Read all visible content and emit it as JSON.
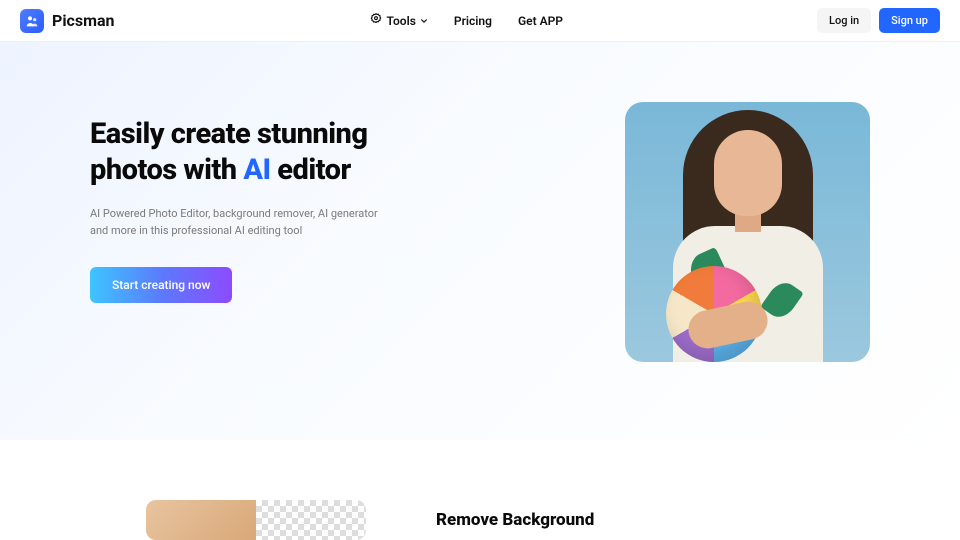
{
  "brand": "Picsman",
  "nav": {
    "tools": "Tools",
    "pricing": "Pricing",
    "getapp": "Get APP"
  },
  "auth": {
    "login": "Log in",
    "signup": "Sign up"
  },
  "hero": {
    "headline_pre": "Easily create stunning photos with ",
    "headline_ai": "AI",
    "headline_post": " editor",
    "subtitle": "AI Powered Photo Editor, background remover, AI generator and more in this professional AI editing tool",
    "cta": "Start creating now"
  },
  "feature": {
    "title": "Remove Background"
  }
}
